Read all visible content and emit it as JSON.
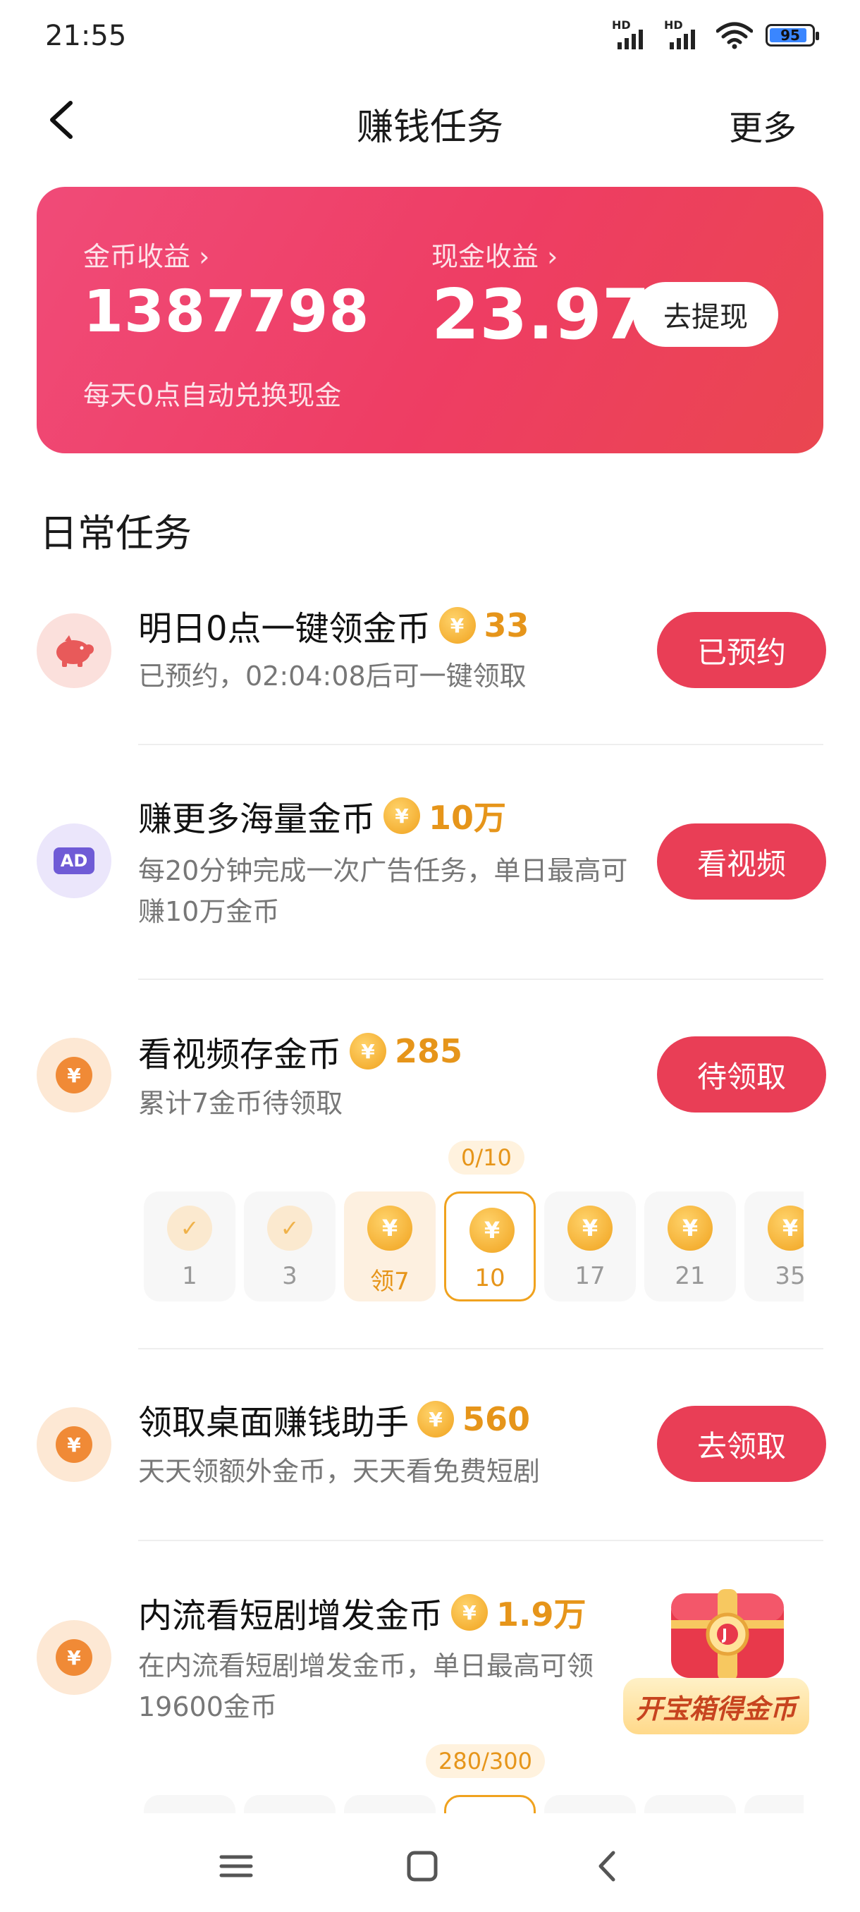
{
  "status_bar": {
    "time": "21:55",
    "battery": "95",
    "hd1": "HD",
    "hd2": "HD"
  },
  "nav": {
    "title": "赚钱任务",
    "more": "更多"
  },
  "earnings": {
    "coin_label": "金币收益",
    "coin_value": "1387798",
    "cash_label": "现金收益",
    "cash_value": "23.97",
    "withdraw_label": "去提现",
    "note": "每天0点自动兑换现金"
  },
  "section_title": "日常任务",
  "tasks": [
    {
      "icon": "piggy-bank-icon",
      "title": "明日0点一键领金币",
      "reward": "33",
      "desc": "已预约，02:04:08后可一键领取",
      "button": "已预约"
    },
    {
      "icon": "ad-icon",
      "icon_text": "AD",
      "title": "赚更多海量金币",
      "reward": "10万",
      "desc": "每20分钟完成一次广告任务，单日最高可赚10万金币",
      "button": "看视频"
    },
    {
      "icon": "yen-coin-icon",
      "title": "看视频存金币",
      "reward": "285",
      "desc": "累计7金币待领取",
      "button": "待领取"
    },
    {
      "icon": "yen-coin-icon",
      "title": "领取桌面赚钱助手",
      "reward": "560",
      "desc": "天天领额外金币，天天看免费短剧",
      "button": "去领取"
    },
    {
      "icon": "yen-coin-icon",
      "title": "内流看短剧增发金币",
      "reward": "1.9万",
      "desc": "在内流看短剧增发金币，单日最高可领19600金币"
    }
  ],
  "coin_symbol": "¥",
  "video_progress": "0/10",
  "video_steps": [
    {
      "label": "1",
      "state": "done"
    },
    {
      "label": "3",
      "state": "done"
    },
    {
      "label": "领7",
      "state": "claim"
    },
    {
      "label": "10",
      "state": "current"
    },
    {
      "label": "17",
      "state": "pending"
    },
    {
      "label": "21",
      "state": "pending"
    },
    {
      "label": "35",
      "state": "pending"
    }
  ],
  "drama_progress": "280/300",
  "treasure_label": "开宝箱得金币",
  "colors": {
    "accent": "#e93e56",
    "coin": "#f0a21e",
    "card_start": "#f04b78",
    "card_end": "#ea4650"
  }
}
